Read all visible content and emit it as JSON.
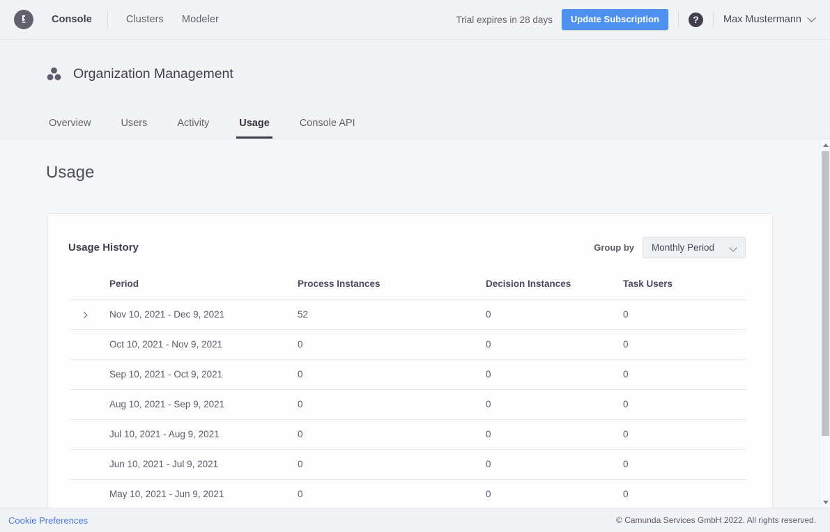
{
  "topnav": {
    "logo_icon": "camunda-logo-icon",
    "items": [
      {
        "label": "Console",
        "active": true
      },
      {
        "label": "Clusters",
        "active": false
      },
      {
        "label": "Modeler",
        "active": false
      }
    ],
    "trial_text": "Trial expires in 28 days",
    "update_button": "Update Subscription",
    "help_icon_glyph": "?",
    "user_name": "Max Mustermann",
    "accent_color": "#4d90f0"
  },
  "page_header": {
    "org_icon": "organization-icon",
    "title": "Organization Management",
    "tabs": [
      {
        "label": "Overview",
        "active": false
      },
      {
        "label": "Users",
        "active": false
      },
      {
        "label": "Activity",
        "active": false
      },
      {
        "label": "Usage",
        "active": true
      },
      {
        "label": "Console API",
        "active": false
      }
    ]
  },
  "main": {
    "page_title": "Usage",
    "card": {
      "title": "Usage History",
      "group_by_label": "Group by",
      "group_by_value": "Monthly Period",
      "group_by_options": [
        "Monthly Period"
      ]
    },
    "table": {
      "columns": [
        "Period",
        "Process Instances",
        "Decision Instances",
        "Task Users"
      ],
      "rows": [
        {
          "expandable": true,
          "period": "Nov 10, 2021 - Dec 9, 2021",
          "process_instances": "52",
          "decision_instances": "0",
          "task_users": "0"
        },
        {
          "expandable": false,
          "period": "Oct 10, 2021 - Nov 9, 2021",
          "process_instances": "0",
          "decision_instances": "0",
          "task_users": "0"
        },
        {
          "expandable": false,
          "period": "Sep 10, 2021 - Oct 9, 2021",
          "process_instances": "0",
          "decision_instances": "0",
          "task_users": "0"
        },
        {
          "expandable": false,
          "period": "Aug 10, 2021 - Sep 9, 2021",
          "process_instances": "0",
          "decision_instances": "0",
          "task_users": "0"
        },
        {
          "expandable": false,
          "period": "Jul 10, 2021 - Aug 9, 2021",
          "process_instances": "0",
          "decision_instances": "0",
          "task_users": "0"
        },
        {
          "expandable": false,
          "period": "Jun 10, 2021 - Jul 9, 2021",
          "process_instances": "0",
          "decision_instances": "0",
          "task_users": "0"
        },
        {
          "expandable": false,
          "period": "May 10, 2021 - Jun 9, 2021",
          "process_instances": "0",
          "decision_instances": "0",
          "task_users": "0"
        }
      ]
    }
  },
  "footer": {
    "cookie_link": "Cookie Preferences",
    "copyright": "© Camunda Services GmbH 2022. All rights reserved."
  }
}
